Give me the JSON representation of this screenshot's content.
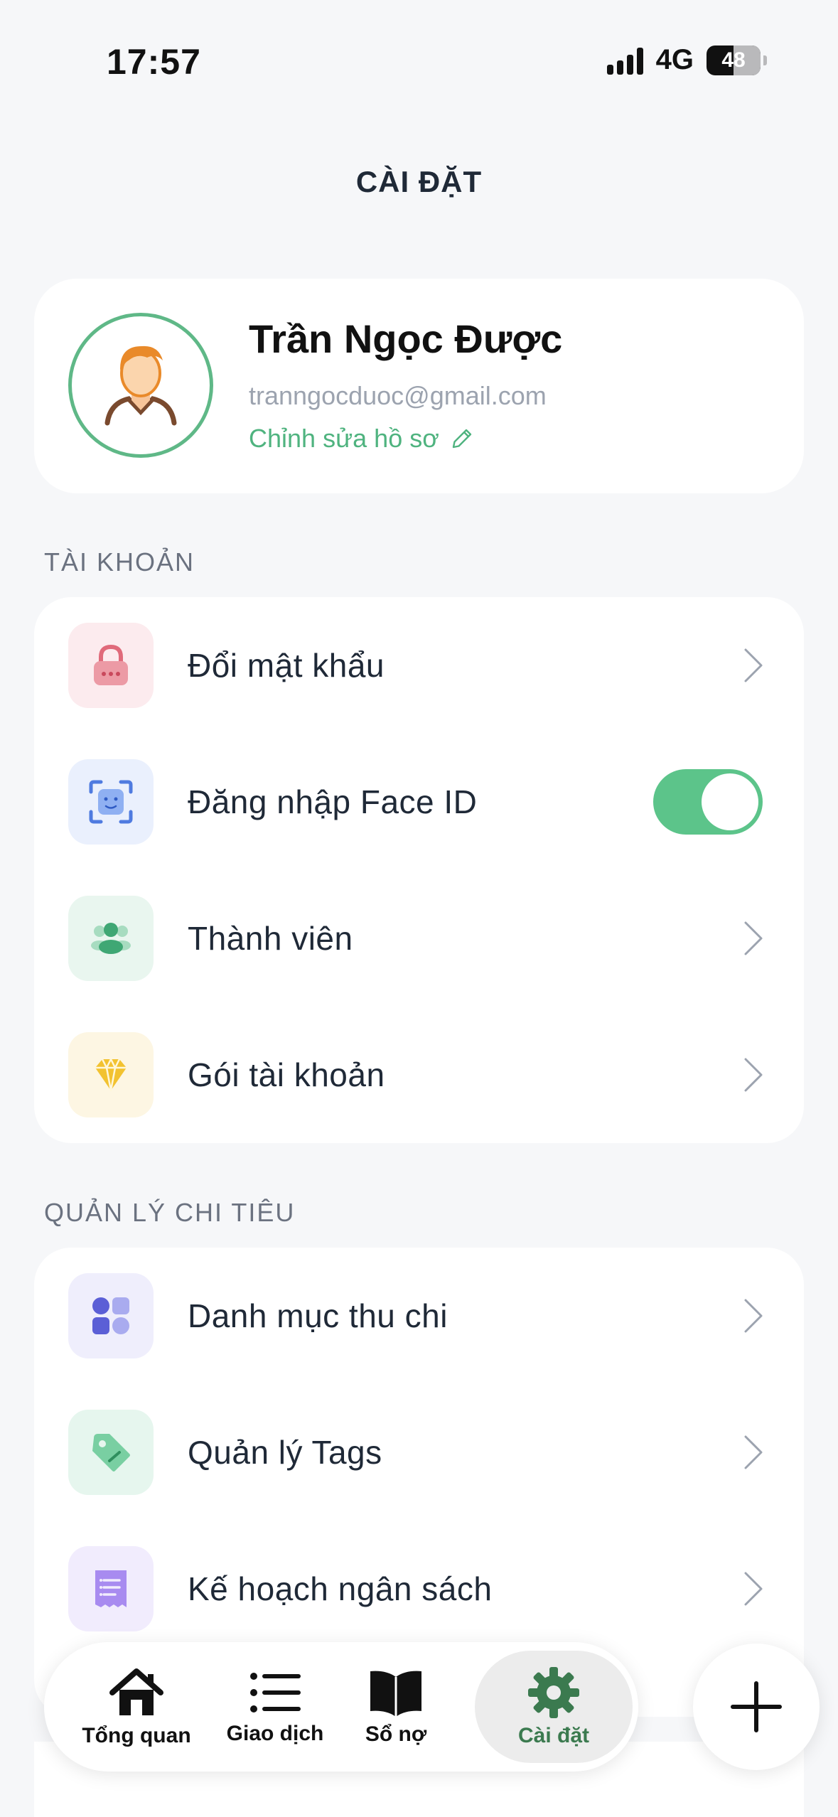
{
  "status_bar": {
    "time": "17:57",
    "network": "4G",
    "battery": "48"
  },
  "header": {
    "title": "CÀI ĐẶT"
  },
  "profile": {
    "name": "Trần Ngọc Được",
    "email": "tranngocduoc@gmail.com",
    "edit_label": "Chỉnh sửa hồ sơ"
  },
  "sections": {
    "account": {
      "title": "TÀI KHOẢN",
      "items": [
        {
          "label": "Đổi mật khẩu",
          "icon": "lock-icon"
        },
        {
          "label": "Đăng nhập Face ID",
          "icon": "face-id-icon",
          "toggle_on": true
        },
        {
          "label": "Thành viên",
          "icon": "members-icon"
        },
        {
          "label": "Gói tài khoản",
          "icon": "diamond-icon"
        }
      ]
    },
    "spending": {
      "title": "QUẢN LÝ CHI TIÊU",
      "items": [
        {
          "label": "Danh mục thu chi",
          "icon": "category-grid-icon"
        },
        {
          "label": "Quản lý Tags",
          "icon": "tag-icon"
        },
        {
          "label": "Kế hoạch ngân sách",
          "icon": "receipt-icon"
        }
      ]
    }
  },
  "tabbar": {
    "tabs": [
      {
        "label": "Tổng quan",
        "icon": "home-icon"
      },
      {
        "label": "Giao dịch",
        "icon": "list-icon"
      },
      {
        "label": "Sổ nợ",
        "icon": "book-icon"
      },
      {
        "label": "Cài đặt",
        "icon": "gear-icon",
        "active": true
      }
    ],
    "fab_icon": "plus-icon"
  },
  "colors": {
    "accent": "#4fb37f",
    "toggle": "#5cc48a",
    "active_tab_text": "#3b7a4f",
    "background": "#f6f7f9"
  }
}
